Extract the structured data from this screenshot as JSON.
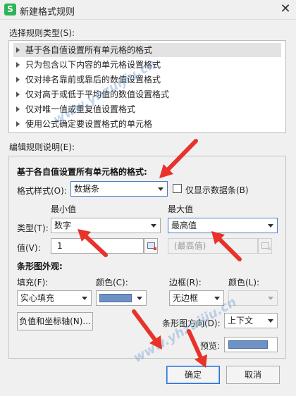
{
  "window": {
    "title": "新建格式规则",
    "app_icon": "S",
    "close_glyph": "✕"
  },
  "rule_type": {
    "label": "选择规则类型(S):",
    "items": [
      {
        "label": "基于各自值设置所有单元格的格式",
        "selected": true
      },
      {
        "label": "只为包含以下内容的单元格设置格式",
        "selected": false
      },
      {
        "label": "仅对排名靠前或靠后的数值设置格式",
        "selected": false
      },
      {
        "label": "仅对高于或低于平均值的数值设置格式",
        "selected": false
      },
      {
        "label": "仅对唯一值或重复值设置格式",
        "selected": false
      },
      {
        "label": "使用公式确定要设置格式的单元格",
        "selected": false
      }
    ]
  },
  "edit": {
    "label": "编辑规则说明(E):",
    "heading": "基于各自值设置所有单元格的格式:",
    "format_style": {
      "label": "格式样式(O):",
      "value": "数据条"
    },
    "show_bar_only": {
      "label": "仅显示数据条(B)",
      "checked": false
    },
    "min_header": "最小值",
    "max_header": "最大值",
    "type": {
      "label": "类型(T):",
      "min_value": "数字",
      "max_value": "最高值"
    },
    "value": {
      "label": "值(V):",
      "min_value": "1",
      "max_value": "(最高值)"
    },
    "bar_appearance": {
      "heading": "条形图外观:",
      "fill_label": "填充(F):",
      "fill_value": "实心填充",
      "color_label": "颜色(C):",
      "border_label": "边框(R):",
      "border_value": "无边框",
      "border_color_label": "颜色(L):",
      "bar_color": "#6f92c6",
      "negative_axis_button": "负值和坐标轴(N)...",
      "direction_label": "条形图方向(D):",
      "direction_value": "上下文",
      "preview_label": "预览:"
    }
  },
  "buttons": {
    "ok": "确定",
    "cancel": "取消"
  },
  "watermark": "www.yhzuijiu.cn",
  "accent_color": "#2e6fd6",
  "annotation_color": "#e8322a"
}
